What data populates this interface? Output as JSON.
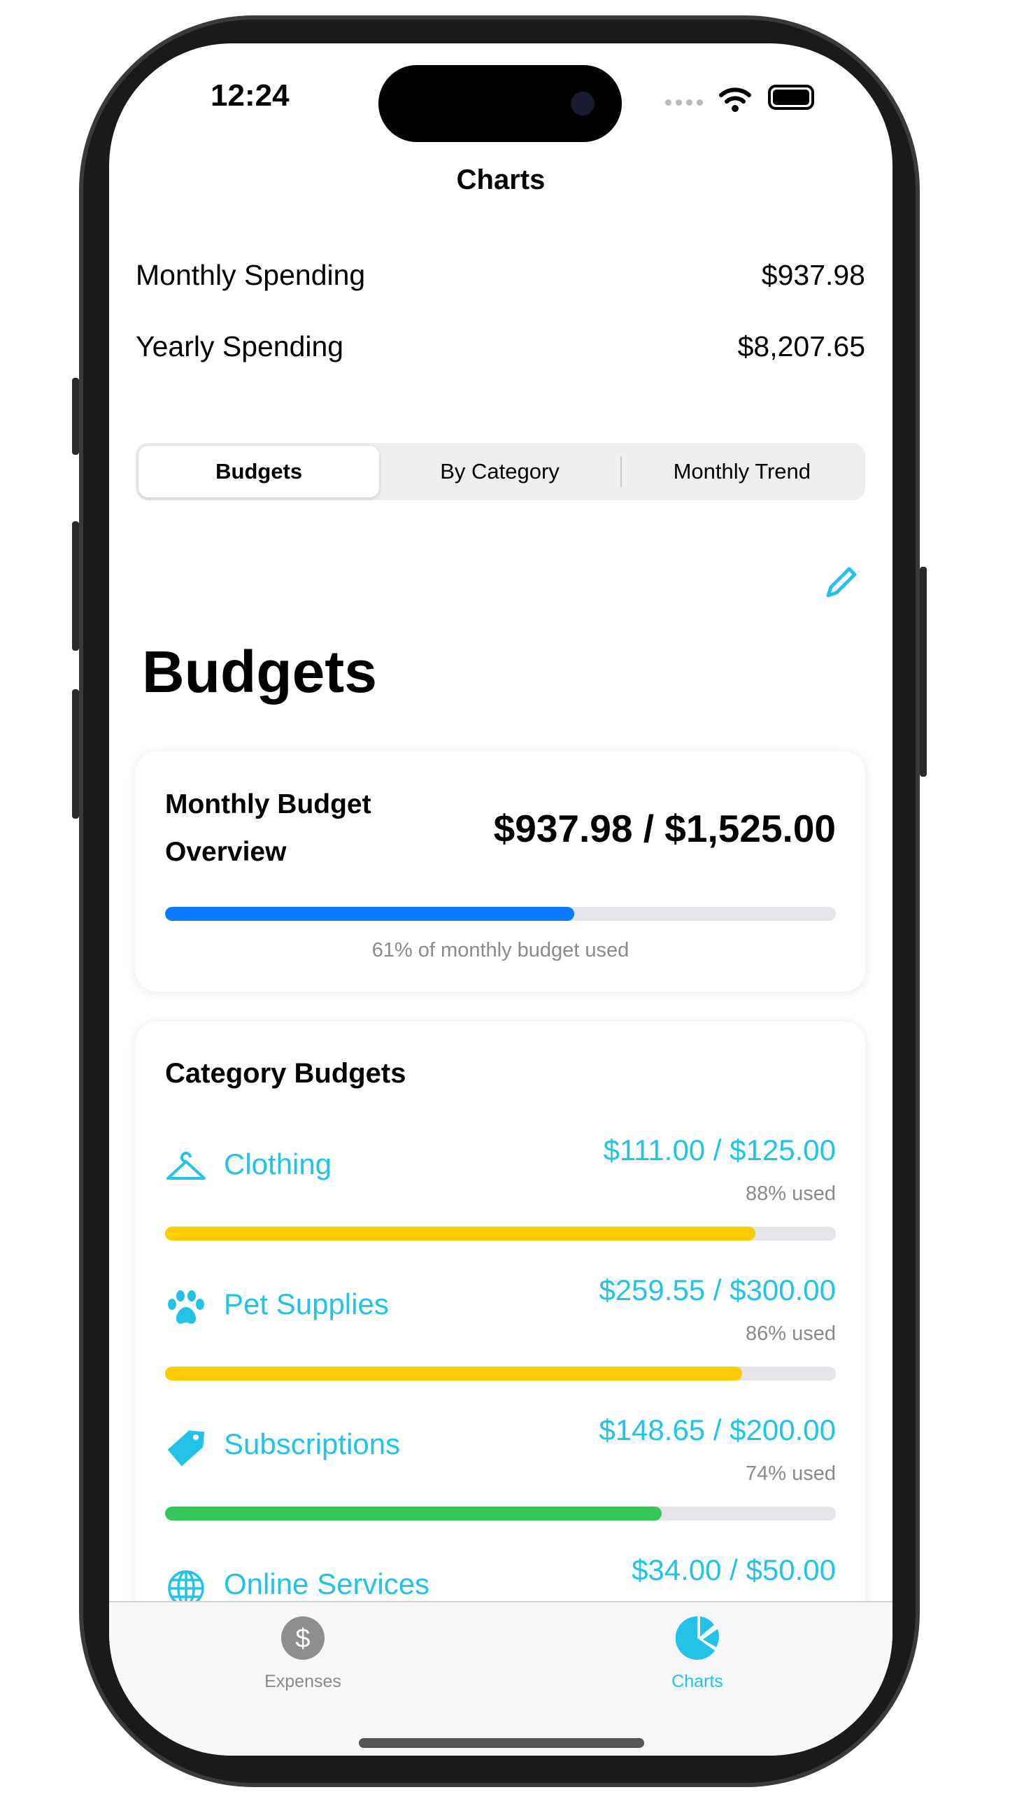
{
  "status": {
    "time": "12:24"
  },
  "nav": {
    "title": "Charts"
  },
  "summary": [
    {
      "label": "Monthly Spending",
      "value": "$937.98"
    },
    {
      "label": "Yearly Spending",
      "value": "$8,207.65"
    }
  ],
  "segments": [
    {
      "label": "Budgets",
      "selected": true
    },
    {
      "label": "By Category",
      "selected": false
    },
    {
      "label": "Monthly Trend",
      "selected": false
    }
  ],
  "heading": "Budgets",
  "overview": {
    "title_line1": "Monthly Budget",
    "title_line2": "Overview",
    "amount": "$937.98 / $1,525.00",
    "percent": 61,
    "caption": "61% of monthly budget used",
    "color": "#0a7aff"
  },
  "category_budgets": {
    "title": "Category Budgets",
    "items": [
      {
        "icon": "hanger-icon",
        "name": "Clothing",
        "amount": "$111.00 / $125.00",
        "used": "88% used",
        "percent": 88,
        "color": "#ffcc00"
      },
      {
        "icon": "paw-icon",
        "name": "Pet Supplies",
        "amount": "$259.55 / $300.00",
        "used": "86% used",
        "percent": 86,
        "color": "#ffcc00"
      },
      {
        "icon": "tag-icon",
        "name": "Subscriptions",
        "amount": "$148.65 / $200.00",
        "used": "74% used",
        "percent": 74,
        "color": "#34c759"
      },
      {
        "icon": "globe-icon",
        "name": "Online Services",
        "amount": "$34.00 / $50.00"
      }
    ]
  },
  "tabs": [
    {
      "label": "Expenses",
      "icon": "dollar-circle-icon",
      "active": false
    },
    {
      "label": "Charts",
      "icon": "pie-chart-icon",
      "active": true
    }
  ],
  "accent": "#22c3e6"
}
